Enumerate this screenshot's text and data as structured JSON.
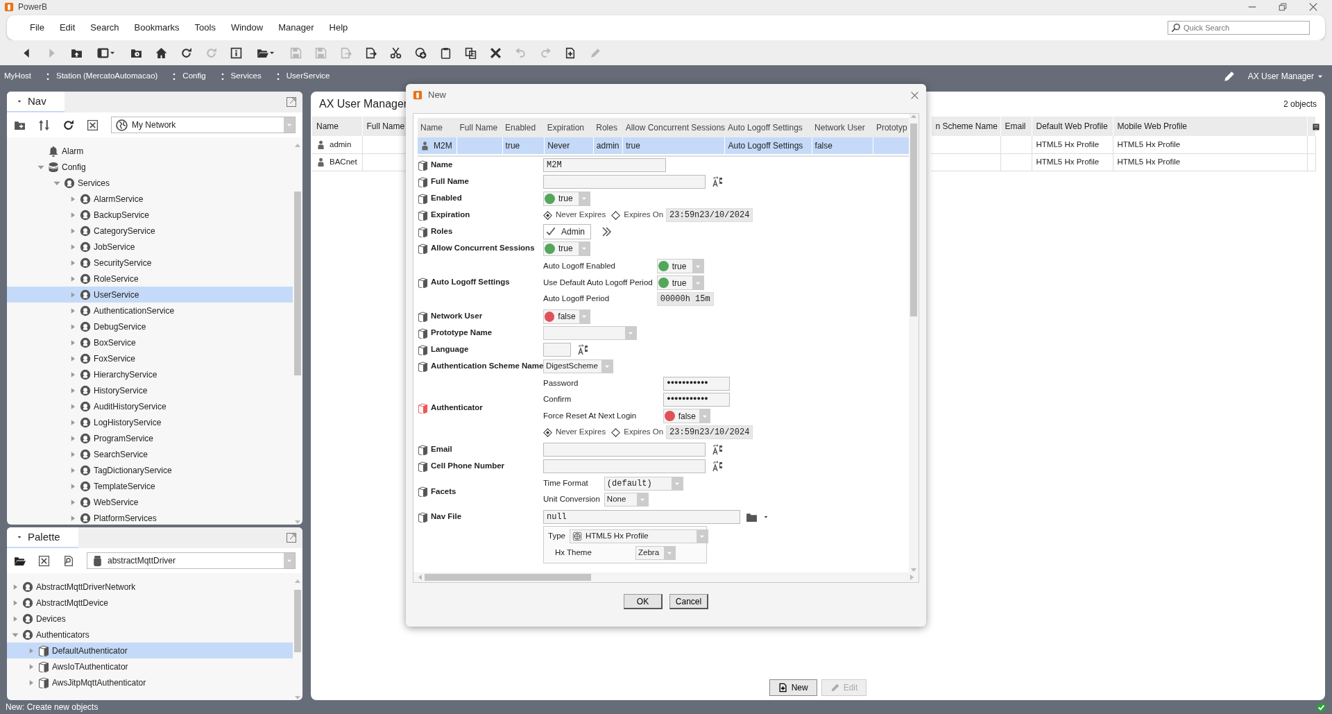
{
  "window": {
    "title": "PowerB"
  },
  "menu": [
    "File",
    "Edit",
    "Search",
    "Bookmarks",
    "Tools",
    "Window",
    "Manager",
    "Help"
  ],
  "quick_search": {
    "placeholder": "Quick Search"
  },
  "toolbar": [
    {
      "disabled": false
    },
    {
      "disabled": true
    },
    {
      "disabled": false
    },
    {
      "disabled": false
    },
    {
      "disabled": false
    },
    {
      "disabled": false
    },
    {
      "disabled": false
    },
    {
      "disabled": true
    },
    {
      "disabled": false
    },
    {
      "disabled": false
    },
    {
      "disabled": true
    },
    {
      "disabled": true
    },
    {
      "disabled": true
    },
    {
      "disabled": false
    },
    {
      "disabled": false
    },
    {
      "disabled": false
    },
    {
      "disabled": false
    },
    {
      "disabled": false
    },
    {
      "disabled": false
    },
    {
      "disabled": true
    },
    {
      "disabled": true
    },
    {
      "disabled": false
    },
    {
      "disabled": true
    }
  ],
  "breadcrumbs": [
    "MyHost",
    "Station (MercatoAutomacao)",
    "Config",
    "Services",
    "UserService"
  ],
  "view_selector": "AX User Manager",
  "nav": {
    "title": "Nav",
    "network": "My Network",
    "tree": [
      {
        "label": "Alarm",
        "selected": false
      },
      {
        "label": "Config",
        "expanded": true,
        "selected": false,
        "children": [
          {
            "label": "Services",
            "expanded": true,
            "selected": false,
            "children": [
              {
                "label": "AlarmService",
                "expanded": false,
                "selected": false
              },
              {
                "label": "BackupService",
                "expanded": false,
                "selected": false
              },
              {
                "label": "CategoryService",
                "expanded": false,
                "selected": false
              },
              {
                "label": "JobService",
                "expanded": false,
                "selected": false
              },
              {
                "label": "SecurityService",
                "expanded": false,
                "selected": false
              },
              {
                "label": "RoleService",
                "expanded": false,
                "selected": false
              },
              {
                "label": "UserService",
                "expanded": false,
                "selected": true
              },
              {
                "label": "AuthenticationService",
                "expanded": false,
                "selected": false
              },
              {
                "label": "DebugService",
                "expanded": false,
                "selected": false
              },
              {
                "label": "BoxService",
                "expanded": false,
                "selected": false
              },
              {
                "label": "FoxService",
                "expanded": false,
                "selected": false
              },
              {
                "label": "HierarchyService",
                "expanded": false,
                "selected": false
              },
              {
                "label": "HistoryService",
                "expanded": false,
                "selected": false
              },
              {
                "label": "AuditHistoryService",
                "expanded": false,
                "selected": false
              },
              {
                "label": "LogHistoryService",
                "expanded": false,
                "selected": false
              },
              {
                "label": "ProgramService",
                "expanded": false,
                "selected": false
              },
              {
                "label": "SearchService",
                "expanded": false,
                "selected": false
              },
              {
                "label": "TagDictionaryService",
                "expanded": false,
                "selected": false
              },
              {
                "label": "TemplateService",
                "expanded": false,
                "selected": false
              },
              {
                "label": "WebService",
                "expanded": false,
                "selected": false
              },
              {
                "label": "PlatformServices",
                "expanded": false,
                "selected": false
              }
            ]
          }
        ]
      }
    ]
  },
  "palette": {
    "title": "Palette",
    "module": "abstractMqttDriver",
    "tree": [
      {
        "label": "AbstractMqttDriverNetwork",
        "expanded": false,
        "selected": false
      },
      {
        "label": "AbstractMqttDevice",
        "expanded": false,
        "selected": false
      },
      {
        "label": "Devices",
        "expanded": false,
        "selected": false
      },
      {
        "label": "Authenticators",
        "expanded": true,
        "selected": false,
        "children": [
          {
            "label": "DefaultAuthenticator",
            "expanded": false,
            "selected": true
          },
          {
            "label": "AwsIoTAuthenticator",
            "expanded": false,
            "selected": false
          },
          {
            "label": "AwsJitpMqttAuthenticator",
            "expanded": false,
            "selected": false
          }
        ]
      }
    ]
  },
  "manager": {
    "title": "AX User Manager",
    "count": "2 objects",
    "columns": [
      "Name",
      "Full Name",
      "n Scheme Name",
      "Email",
      "Default Web Profile",
      "Mobile Web Profile"
    ],
    "rows": [
      {
        "name": "admin",
        "default_web_profile": "HTML5 Hx Profile",
        "mobile_web_profile": "HTML5 Hx Profile",
        "selected": false
      },
      {
        "name": "BACnet",
        "default_web_profile": "HTML5 Hx Profile",
        "mobile_web_profile": "HTML5 Hx Profile",
        "selected": false
      }
    ],
    "buttons": [
      {
        "label": "New",
        "disabled": false
      },
      {
        "label": "Edit",
        "disabled": true
      }
    ]
  },
  "dialog": {
    "title": "New",
    "columns": [
      "Name",
      "Full Name",
      "Enabled",
      "Expiration",
      "Roles",
      "Allow Concurrent Sessions",
      "Auto Logoff Settings",
      "Network User",
      "Prototyp"
    ],
    "rows": [
      {
        "cells": [
          "M2M",
          null,
          "true",
          "Never",
          "admin",
          "true",
          "Auto Logoff Settings",
          "false",
          null
        ],
        "selected": true
      }
    ],
    "properties": [
      {
        "label": "Name",
        "kind": "text",
        "value": "M2M",
        "ab_button": false
      },
      {
        "label": "Full Name",
        "kind": "text",
        "ab_button": true
      },
      {
        "label": "Enabled",
        "kind": "bool",
        "value": "true",
        "on": true
      },
      {
        "label": "Expiration",
        "kind": "expiration",
        "options": [
          {
            "label": "Never Expires",
            "selected": true
          },
          {
            "label": "Expires On",
            "selected": false
          }
        ],
        "date": "23:59n23/10/2024"
      },
      {
        "label": "Roles",
        "kind": "roles",
        "value": "Admin",
        "checked": true
      },
      {
        "label": "Allow Concurrent Sessions",
        "kind": "bool",
        "value": "true",
        "on": true
      },
      {
        "label": "Auto Logoff Settings",
        "kind": "group",
        "fields": [
          {
            "label": "Auto Logoff Enabled",
            "kind": "bool",
            "value": "true",
            "on": true
          },
          {
            "label": "Use Default Auto Logoff Period",
            "kind": "bool",
            "value": "true",
            "on": true
          },
          {
            "label": "Auto Logoff Period",
            "kind": "readonly",
            "value": "00000h 15m"
          }
        ]
      },
      {
        "label": "Network User",
        "kind": "bool",
        "value": "false",
        "on": false
      },
      {
        "label": "Prototype Name",
        "kind": "select"
      },
      {
        "label": "Language",
        "kind": "short_text",
        "ab_button": true
      },
      {
        "label": "Authentication Scheme Name",
        "kind": "select",
        "value": "DigestScheme"
      },
      {
        "label": "Authenticator",
        "kind": "group",
        "invalid": true,
        "fields": [
          {
            "label": "Password",
            "kind": "password",
            "value": "●●●●●●●●●●●"
          },
          {
            "label": "Confirm",
            "kind": "password",
            "value": "●●●●●●●●●●●"
          },
          {
            "label": "Force Reset At Next Login",
            "kind": "bool",
            "value": "false",
            "on": false
          },
          {
            "kind": "expiration",
            "options": [
              {
                "label": "Never Expires",
                "selected": true
              },
              {
                "label": "Expires On",
                "selected": false
              }
            ],
            "date": "23:59n23/10/2024"
          }
        ]
      },
      {
        "label": "Email",
        "kind": "text",
        "ab_button": true
      },
      {
        "label": "Cell Phone Number",
        "kind": "text",
        "ab_button": true
      },
      {
        "label": "Facets",
        "kind": "group",
        "fields": [
          {
            "label": "Time Format",
            "kind": "mono_select",
            "value": "(default)"
          },
          {
            "label": "Unit Conversion",
            "kind": "select",
            "value": "None"
          }
        ]
      },
      {
        "label": "Nav File",
        "kind": "navfile",
        "value": "null"
      },
      {
        "kind": "profile",
        "type_label": "Type",
        "type_value": "HTML5 Hx Profile",
        "theme_label": "Hx Theme",
        "theme_value": "Zebra"
      }
    ],
    "buttons": [
      "OK",
      "Cancel"
    ]
  },
  "status_bar": "New: Create new objects"
}
